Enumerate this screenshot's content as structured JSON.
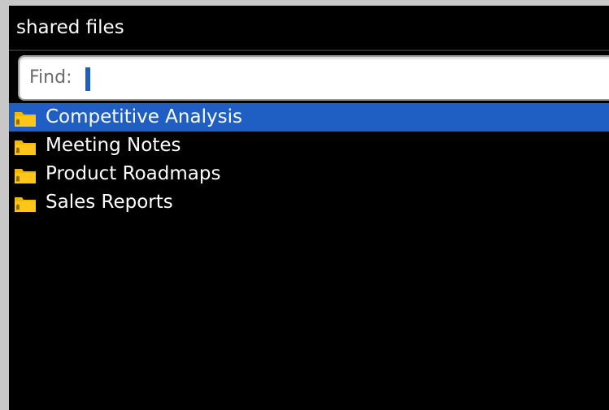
{
  "window": {
    "title": "shared files"
  },
  "search": {
    "label": "Find:",
    "value": ""
  },
  "colors": {
    "background": "#000000",
    "selection": "#1f5fc4",
    "folder": "#f5b800",
    "text": "#ffffff"
  },
  "folders": [
    {
      "label": "Competitive Analysis",
      "icon": "folder-icon",
      "selected": true
    },
    {
      "label": "Meeting Notes",
      "icon": "folder-icon",
      "selected": false
    },
    {
      "label": "Product Roadmaps",
      "icon": "folder-icon",
      "selected": false
    },
    {
      "label": "Sales Reports",
      "icon": "folder-icon",
      "selected": false
    }
  ]
}
